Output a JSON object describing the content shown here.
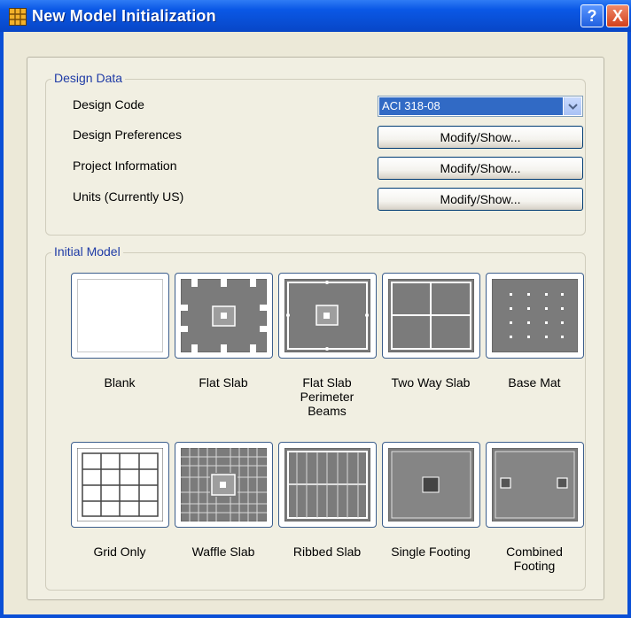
{
  "window": {
    "title": "New Model Initialization",
    "help_label": "?",
    "close_label": "X"
  },
  "design_data": {
    "legend": "Design Data",
    "rows": [
      {
        "label": "Design Code"
      },
      {
        "label": "Design Preferences",
        "button": "Modify/Show..."
      },
      {
        "label": "Project Information",
        "button": "Modify/Show..."
      },
      {
        "label": "Units  (Currently US)",
        "button": "Modify/Show..."
      }
    ],
    "design_code_value": "ACI 318-08"
  },
  "initial_model": {
    "legend": "Initial Model",
    "tiles": [
      {
        "label": "Blank",
        "icon": "blank-icon"
      },
      {
        "label": "Flat Slab",
        "icon": "flat-slab-icon"
      },
      {
        "label": "Flat Slab\nPerimeter\nBeams",
        "icon": "flat-slab-perimeter-beams-icon"
      },
      {
        "label": "Two Way Slab",
        "icon": "two-way-slab-icon"
      },
      {
        "label": "Base Mat",
        "icon": "base-mat-icon"
      },
      {
        "label": "Grid Only",
        "icon": "grid-only-icon"
      },
      {
        "label": "Waffle Slab",
        "icon": "waffle-slab-icon"
      },
      {
        "label": "Ribbed Slab",
        "icon": "ribbed-slab-icon"
      },
      {
        "label": "Single Footing",
        "icon": "single-footing-icon"
      },
      {
        "label": "Combined\nFooting",
        "icon": "combined-footing-icon"
      }
    ]
  },
  "colors": {
    "title_bar": "#0a58e6",
    "selection": "#316ac5",
    "dialog_bg": "#ece9d8",
    "slab_gray": "#7d7d7d"
  }
}
